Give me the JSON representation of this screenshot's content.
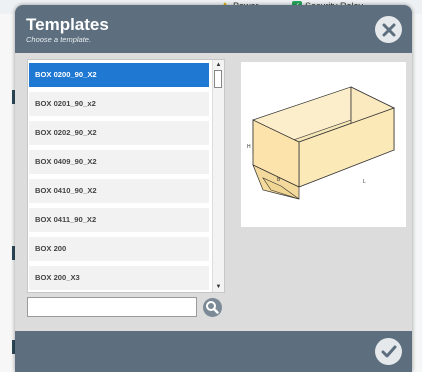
{
  "background": {
    "tabs": [
      {
        "label": "Power",
        "icon": "warning-icon"
      },
      {
        "label": "Security Relay",
        "icon": "checkbox-icon"
      }
    ]
  },
  "dialog": {
    "title": "Templates",
    "subtitle": "Choose a template.",
    "close_icon": "close-icon",
    "confirm_icon": "checkmark-icon",
    "header_color": "#5d6f7e",
    "selected_color": "#1f78d1"
  },
  "template_list": {
    "selected_index": 0,
    "items": [
      "BOX 0200_90_X2",
      "BOX 0201_90_x2",
      "BOX 0202_90_X2",
      "BOX 0409_90_X2",
      "BOX 0410_90_X2",
      "BOX 0411_90_X2",
      "BOX 200",
      "BOX 200_X3"
    ]
  },
  "search": {
    "value": "",
    "placeholder": "",
    "icon": "search-icon"
  },
  "preview": {
    "dimension_labels": {
      "height": "H",
      "width": "B",
      "length": "L"
    }
  }
}
